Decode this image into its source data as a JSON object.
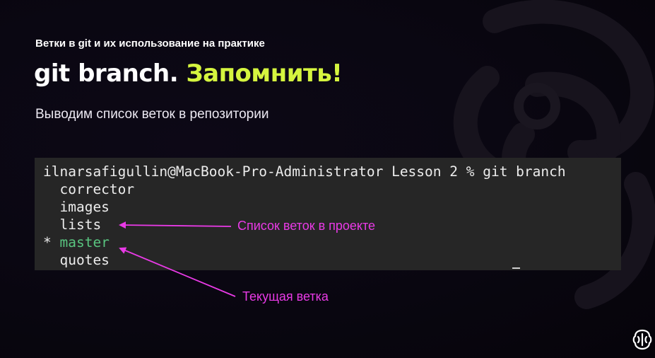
{
  "slide": {
    "subtitle": "Ветки в git и их использование на практике",
    "title_main": "git branch.",
    "title_accent": "Запомнить!",
    "description": "Выводим список веток в репозитории"
  },
  "terminal": {
    "prompt_line": "ilnarsafigullin@MacBook-Pro-Administrator Lesson 2 % git branch",
    "branches": [
      {
        "prefix": "  ",
        "name": "corrector",
        "current": false
      },
      {
        "prefix": "  ",
        "name": "images",
        "current": false
      },
      {
        "prefix": "  ",
        "name": "lists",
        "current": false
      },
      {
        "prefix": "* ",
        "name": "master",
        "current": true
      },
      {
        "prefix": "  ",
        "name": "quotes",
        "current": false
      }
    ]
  },
  "annotations": {
    "branch_list": "Список веток в проекте",
    "current_branch": "Текущая ветка"
  },
  "colors": {
    "accent": "#d5f53f",
    "annotation": "#e93ae6",
    "current_branch": "#59c47f",
    "terminal_bg": "#262626"
  },
  "icons": {
    "background": "brain-logo-watermark",
    "corner": "brain-logo-icon"
  }
}
